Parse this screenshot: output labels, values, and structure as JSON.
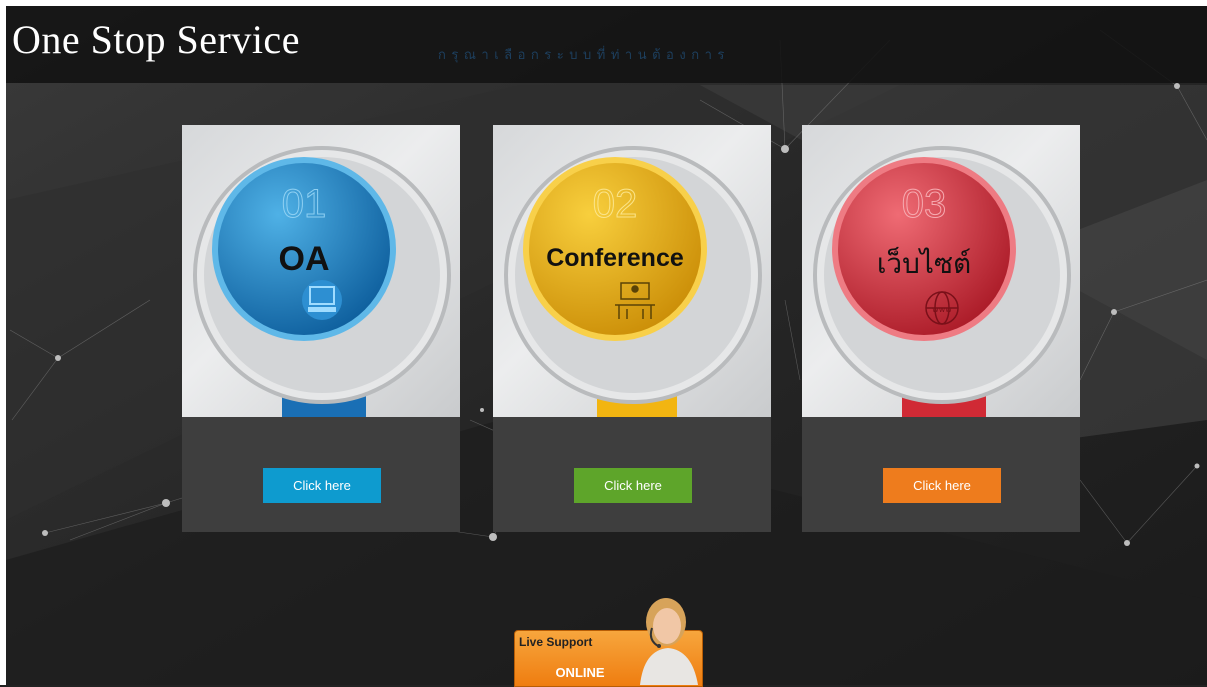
{
  "header": {
    "title": "One Stop Service",
    "tagline": "กรุณาเลือกระบบที่ท่านต้องการ"
  },
  "cards": [
    {
      "number": "01",
      "label": "OA",
      "icon": "computer-icon",
      "button": "Click here",
      "color": "#1a6fb5",
      "button_color": "#0e9bcf"
    },
    {
      "number": "02",
      "label": "Conference",
      "icon": "meeting-icon",
      "button": "Click here",
      "color": "#f2b511",
      "button_color": "#5ea52a"
    },
    {
      "number": "03",
      "label": "เว็บไซต์",
      "icon": "globe-www-icon",
      "button": "Click here",
      "color": "#d02a35",
      "button_color": "#ee7c1d"
    }
  ],
  "live_support": {
    "title": "Live Support",
    "status": "ONLINE"
  }
}
